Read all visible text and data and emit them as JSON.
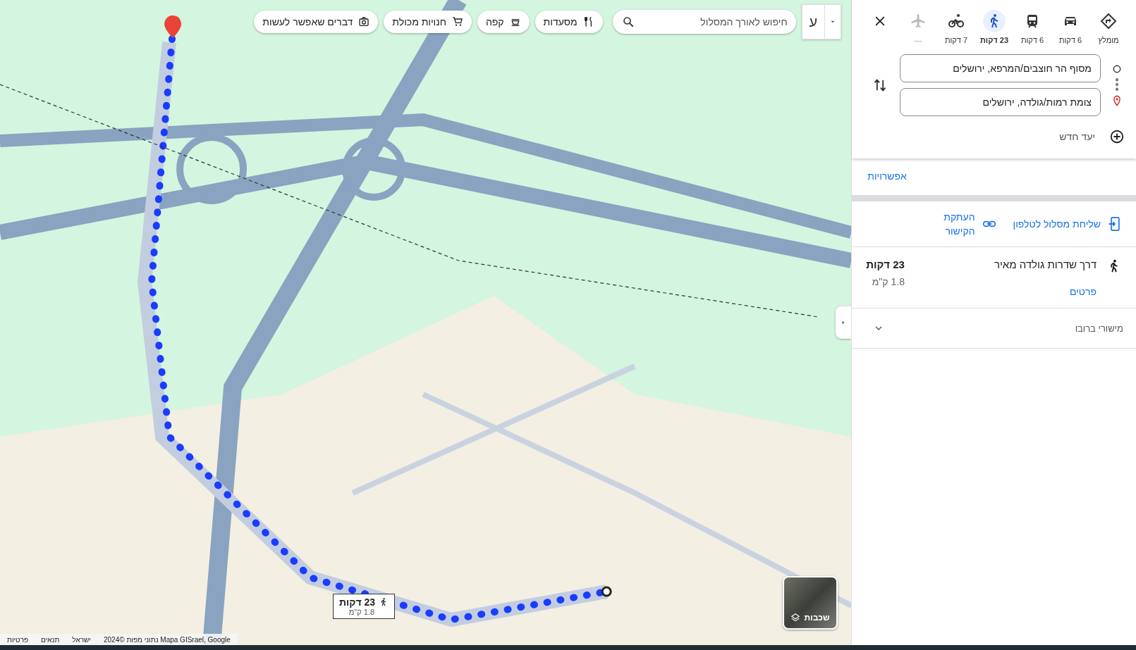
{
  "map": {
    "kind": "picture",
    "search": {
      "placeholder": "חיפוש לאורך המסלול"
    },
    "chips": [
      {
        "label": "מסעדות",
        "kind": "restaurant"
      },
      {
        "label": "קפה",
        "kind": "coffee"
      },
      {
        "label": "חנויות מכולת",
        "kind": "cart"
      },
      {
        "label": "דברים שאפשר לעשות",
        "kind": "camera"
      }
    ],
    "input_tool": {
      "label": "ע"
    },
    "route_callout": {
      "time": "23 דקות",
      "distance": "1.8 ק\"מ"
    },
    "layers": {
      "label": "שכבות"
    },
    "attribution": [
      "2024© נתוני מפות Mapa GISrael, Google",
      "ישראל",
      "תנאים",
      "פרטיות"
    ]
  },
  "panel": {
    "modes": [
      {
        "kind": "best",
        "label": "מומלץ",
        "selected": false,
        "disabled": false
      },
      {
        "kind": "car",
        "label": "6 דקות",
        "selected": false,
        "disabled": false
      },
      {
        "kind": "transit",
        "label": "6 דקות",
        "selected": false,
        "disabled": false
      },
      {
        "kind": "walk",
        "label": "23 דקות",
        "selected": true,
        "disabled": false
      },
      {
        "kind": "bike",
        "label": "7 דקות",
        "selected": false,
        "disabled": false
      },
      {
        "kind": "flight",
        "label": "—",
        "selected": false,
        "disabled": true
      }
    ],
    "origin": {
      "value": "מסוף הר חוצבים/המרפא, ירושלים"
    },
    "destination": {
      "value": "צומת רמות/גולדה, ירושלים"
    },
    "add_destination": "יעד חדש",
    "options_link": "אפשרויות",
    "send_to_phone": "שליחת מסלול לטלפון",
    "copy_link": "העתקת הקישור",
    "route": {
      "name": "דרך שדרות גולדה מאיר",
      "time": "23 דקות",
      "distance": "1.8 ק\"מ",
      "details": "פרטים"
    },
    "terrain": {
      "label": "מישורי ברובו",
      "expanded": false
    }
  }
}
